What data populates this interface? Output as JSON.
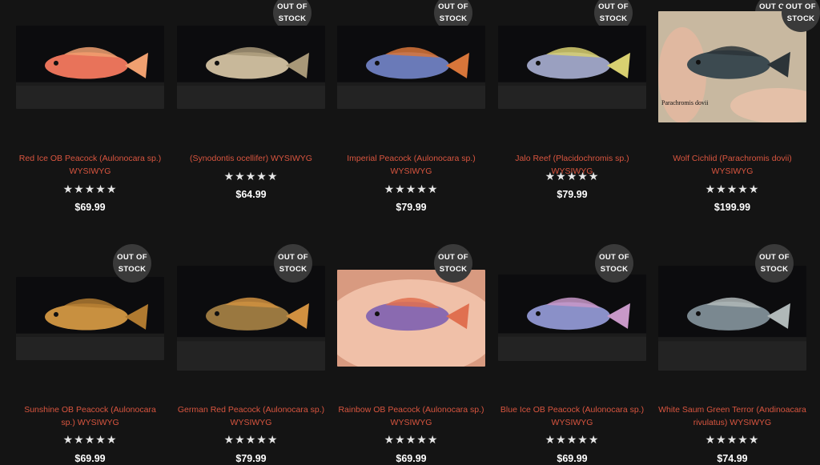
{
  "products": [
    {
      "title": "Red Ice OB Peacock (Aulonocara sp.) WYSIWYG",
      "price": "$69.99",
      "badge": [
        "OUT OF",
        "STOCK"
      ],
      "stars": "★★★★★",
      "body_color": "#e8735a",
      "fin_color": "#f0a070"
    },
    {
      "title": "(Synodontis ocellifer) WYSIWYG",
      "price": "$64.99",
      "badge": [
        "OUT OF",
        "STOCK"
      ],
      "stars": "★★★★★",
      "body_color": "#c8b89a",
      "fin_color": "#a89878"
    },
    {
      "title": "Imperial Peacock (Aulonocara sp.) WYSIWYG",
      "price": "$79.99",
      "badge": [
        "OUT OF",
        "STOCK"
      ],
      "stars": "★★★★★",
      "body_color": "#6a7ab8",
      "fin_color": "#d8763a"
    },
    {
      "title": "Jalo Reef (Placidochromis sp.) WYSIWYG",
      "price": "$79.99",
      "badge": [
        "OUT OF",
        "STOCK"
      ],
      "stars": "★★★★★",
      "body_color": "#9aa0c0",
      "fin_color": "#d8d070"
    },
    {
      "title": "Wolf Cichlid (Parachromis dovii) WYSIWYG",
      "price": "$199.99",
      "badge": [
        "OUT OF",
        "STOCK"
      ],
      "stars": "★★★★★",
      "body_color": "#3c4a50",
      "fin_color": "#2c3438",
      "caption": "Parachromis dovii"
    },
    {
      "title": "Sunshine OB Peacock (Aulonocara sp.) WYSIWYG",
      "price": "$69.99",
      "badge": [
        "OUT OF",
        "STOCK"
      ],
      "stars": "★★★★★",
      "body_color": "#c89040",
      "fin_color": "#b07a30"
    },
    {
      "title": "German Red Peacock (Aulonocara sp.) WYSIWYG",
      "price": "$79.99",
      "badge": [
        "OUT OF",
        "STOCK"
      ],
      "stars": "★★★★★",
      "body_color": "#9a7840",
      "fin_color": "#d09040"
    },
    {
      "title": "Rainbow OB Peacock (Aulonocara sp.) WYSIWYG",
      "price": "$69.99",
      "badge": [
        "OUT OF",
        "STOCK"
      ],
      "stars": "★★★★★",
      "body_color": "#8a6ab0",
      "fin_color": "#e07050"
    },
    {
      "title": "Blue Ice OB Peacock (Aulonocara sp.) WYSIWYG",
      "price": "$69.99",
      "badge": [
        "OUT OF",
        "STOCK"
      ],
      "stars": "★★★★★",
      "body_color": "#8a90c8",
      "fin_color": "#c898c8"
    },
    {
      "title": "White Saum Green Terror (Andinoacara rivulatus) WYSIWYG",
      "price": "$74.99",
      "badge": [
        "OUT OF",
        "STOCK"
      ],
      "stars": "★★★★★",
      "body_color": "#7a8890",
      "fin_color": "#b0b8b8"
    }
  ]
}
